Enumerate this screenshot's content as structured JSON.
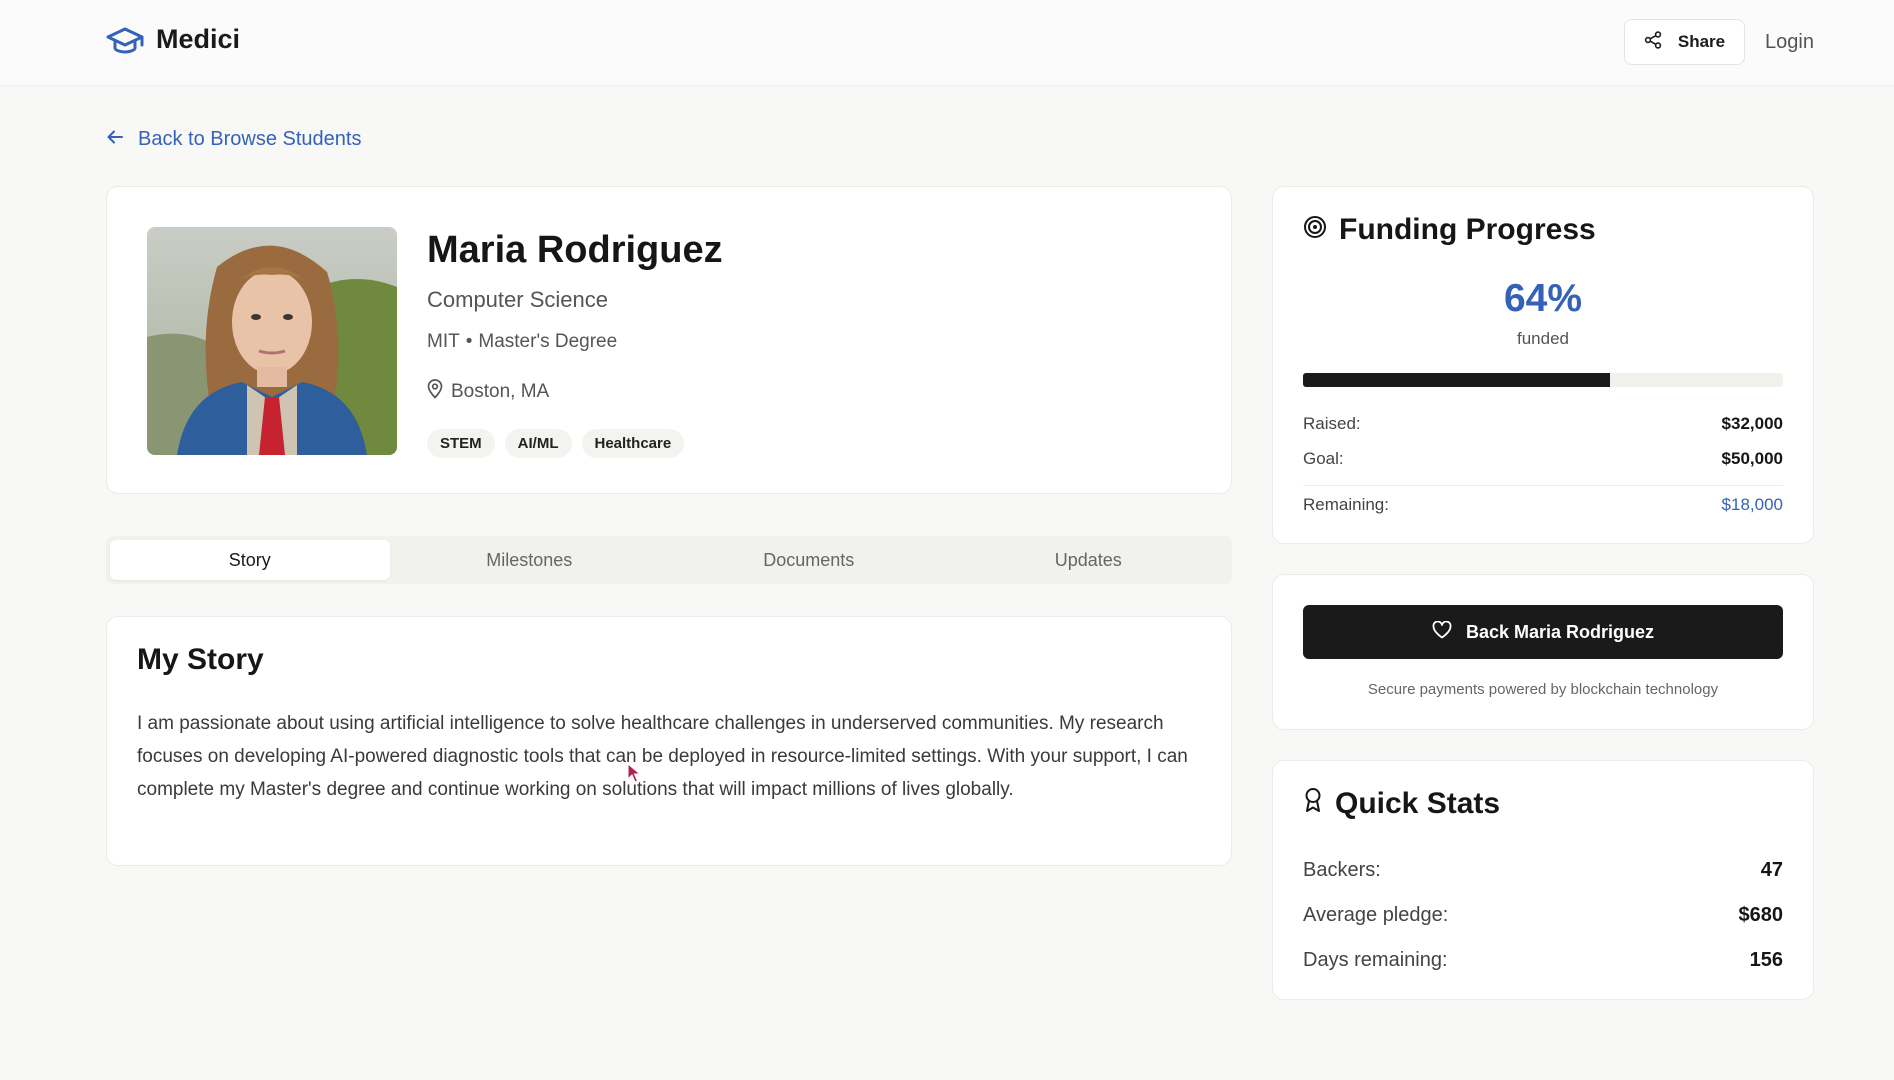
{
  "brand": {
    "name": "Medici"
  },
  "header": {
    "share_label": "Share",
    "login_label": "Login"
  },
  "back_link": {
    "label": "Back to Browse Students"
  },
  "student": {
    "name": "Maria Rodriguez",
    "major": "Computer Science",
    "school": "MIT",
    "school_separator": "•",
    "degree": "Master's Degree",
    "location": "Boston, MA",
    "tags": [
      "STEM",
      "AI/ML",
      "Healthcare"
    ]
  },
  "tabs": [
    {
      "label": "Story",
      "active": true
    },
    {
      "label": "Milestones",
      "active": false
    },
    {
      "label": "Documents",
      "active": false
    },
    {
      "label": "Updates",
      "active": false
    }
  ],
  "story": {
    "title": "My Story",
    "text": "I am passionate about using artificial intelligence to solve healthcare challenges in underserved communities. My research focuses on developing AI-powered diagnostic tools that can be deployed in resource-limited settings. With your support, I can complete my Master's degree and continue working on solutions that will impact millions of lives globally."
  },
  "funding": {
    "title": "Funding Progress",
    "percent_label": "64%",
    "progress_fraction": 0.64,
    "funded_label": "funded",
    "raised_label": "Raised:",
    "raised_value": "$32,000",
    "goal_label": "Goal:",
    "goal_value": "$50,000",
    "remaining_label": "Remaining:",
    "remaining_value": "$18,000"
  },
  "back_card": {
    "button_label": "Back Maria Rodriguez",
    "note": "Secure payments powered by blockchain technology"
  },
  "quick_stats": {
    "title": "Quick Stats",
    "backers_label": "Backers:",
    "backers_value": "47",
    "avg_label": "Average pledge:",
    "avg_value": "$680",
    "days_label": "Days remaining:",
    "days_value": "156"
  },
  "colors": {
    "accent": "#3562b8",
    "dark": "#1a1a1a",
    "background": "#f8f8f7"
  },
  "icons": {
    "logo": "graduation-cap-icon",
    "share": "share-icon",
    "back": "arrow-left-icon",
    "location": "map-pin-icon",
    "funding": "target-icon",
    "back_button": "heart-icon",
    "quick_stats": "award-icon"
  }
}
